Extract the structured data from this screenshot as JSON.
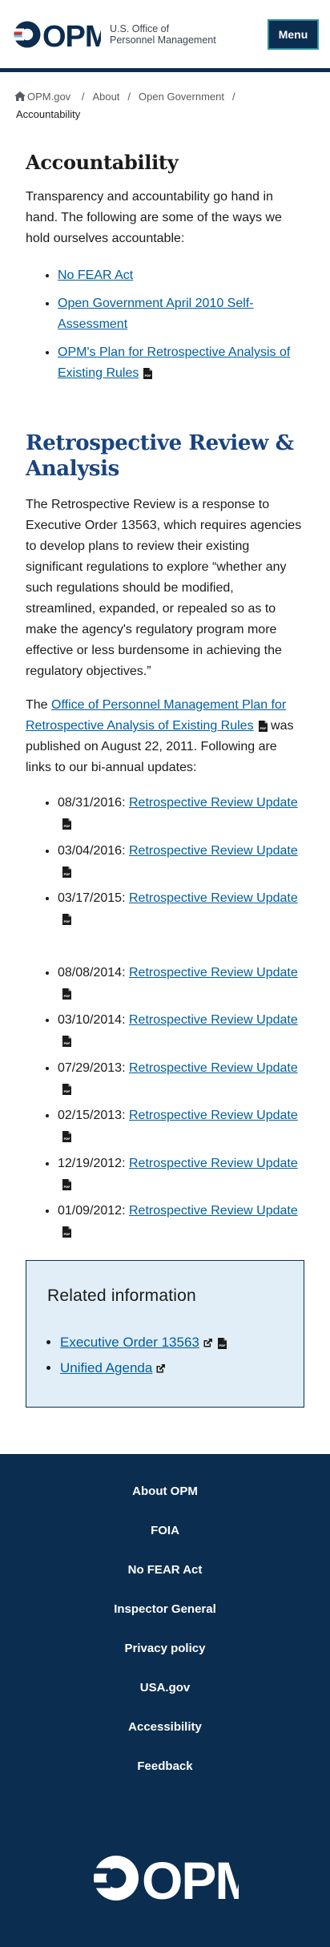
{
  "header": {
    "logo_text": "OPM",
    "agency_line1": "U.S. Office of",
    "agency_line2": "Personnel Management",
    "menu_label": "Menu"
  },
  "breadcrumb": {
    "items": [
      "OPM.gov",
      "About",
      "Open Government"
    ],
    "current": "Accountability"
  },
  "accountability": {
    "title": "Accountability",
    "intro": "Transparency and accountability go hand in hand. The following are some of the ways we hold ourselves accountable:",
    "links": [
      {
        "label": "No FEAR Act"
      },
      {
        "label": "Open Government April 2010 Self-Assessment"
      },
      {
        "label": "OPM's Plan for Retrospective Analysis of Existing Rules",
        "icon": "pdf-icon"
      }
    ]
  },
  "retrospective": {
    "title": "Retrospective Review & Analysis",
    "para1": "The Retrospective Review is a response to Executive Order 13563, which requires agencies to develop plans to review their existing significant regulations to explore “whether any such regulations should be modified, streamlined, expanded, or repealed so as to make the agency's regulatory program more effective or less burdensome in achieving the regulatory objectives.”",
    "para2_prefix": "The ",
    "para2_link": "Office of Personnel Management Plan for Retrospective Analysis of Existing Rules",
    "para2_suffix": " was published on August 22, 2011. Following are links to our bi-annual updates:",
    "updates_a": [
      {
        "date": "08/31/2016:",
        "label": "Retrospective Review Update"
      },
      {
        "date": "03/04/2016:",
        "label": "Retrospective Review Update"
      },
      {
        "date": "03/17/2015:",
        "label": "Retrospective Review Update"
      }
    ],
    "updates_b": [
      {
        "date": "08/08/2014:",
        "label": "Retrospective Review Update"
      },
      {
        "date": "03/10/2014:",
        "label": "Retrospective Review Update"
      },
      {
        "date": "07/29/2013:",
        "label": "Retrospective Review Update"
      },
      {
        "date": "02/15/2013:",
        "label": "Retrospective Review Update"
      },
      {
        "date": "12/19/2012:",
        "label": "Retrospective Review Update"
      },
      {
        "date": "01/09/2012:",
        "label": "Retrospective Review Update"
      }
    ]
  },
  "related": {
    "title": "Related information",
    "links": [
      {
        "label": "Executive Order 13563"
      },
      {
        "label": "Unified Agenda"
      }
    ]
  },
  "footer": {
    "links": [
      "About OPM",
      "FOIA",
      "No FEAR Act",
      "Inspector General",
      "Privacy policy",
      "USA.gov",
      "Accessibility",
      "Feedback"
    ],
    "logo_text": "OPM"
  },
  "colors": {
    "navy": "#0b2d4f",
    "link": "#005ea2",
    "heading_blue": "#1a4480",
    "logo_red": "#d83933",
    "logo_lightblue": "#7fb7d9",
    "related_bg": "#e1eef7"
  }
}
